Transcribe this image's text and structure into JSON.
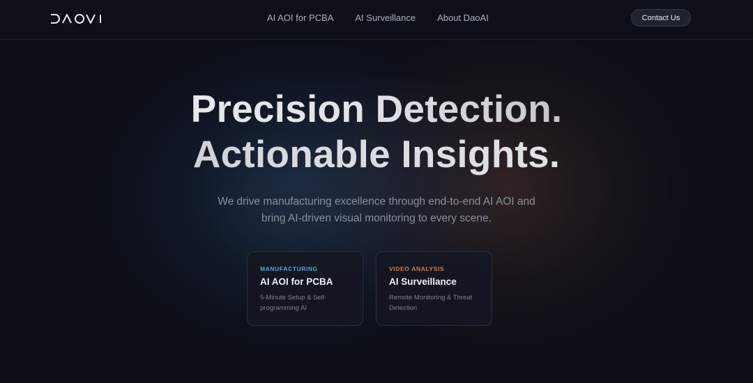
{
  "brand": {
    "logo_text": "DAOAI"
  },
  "nav": {
    "items": [
      {
        "label": "AI AOI for PCBA"
      },
      {
        "label": "AI Surveillance"
      },
      {
        "label": "About DaoAI"
      }
    ],
    "contact_label": "Contact Us"
  },
  "hero": {
    "title_line1": "Precision Detection.",
    "title_line2": "Actionable Insights.",
    "subtitle_line1": "We drive manufacturing excellence through end-to-end AI AOI and",
    "subtitle_line2": "bring AI-driven visual monitoring to every scene."
  },
  "cards": [
    {
      "kicker": "MANUFACTURING",
      "title": "AI AOI for PCBA",
      "desc_line1": "5-Minute Setup & Self-",
      "desc_line2": "programming AI"
    },
    {
      "kicker": "VIDEO ANALYSIS",
      "title": "AI Surveillance",
      "desc_line1": "Remote Monitoring & Threat",
      "desc_line2": "Detection"
    }
  ],
  "colors": {
    "background": "#0c0f18",
    "manufacturing_accent": "#4ba6d8",
    "video_accent": "#e4783a"
  }
}
